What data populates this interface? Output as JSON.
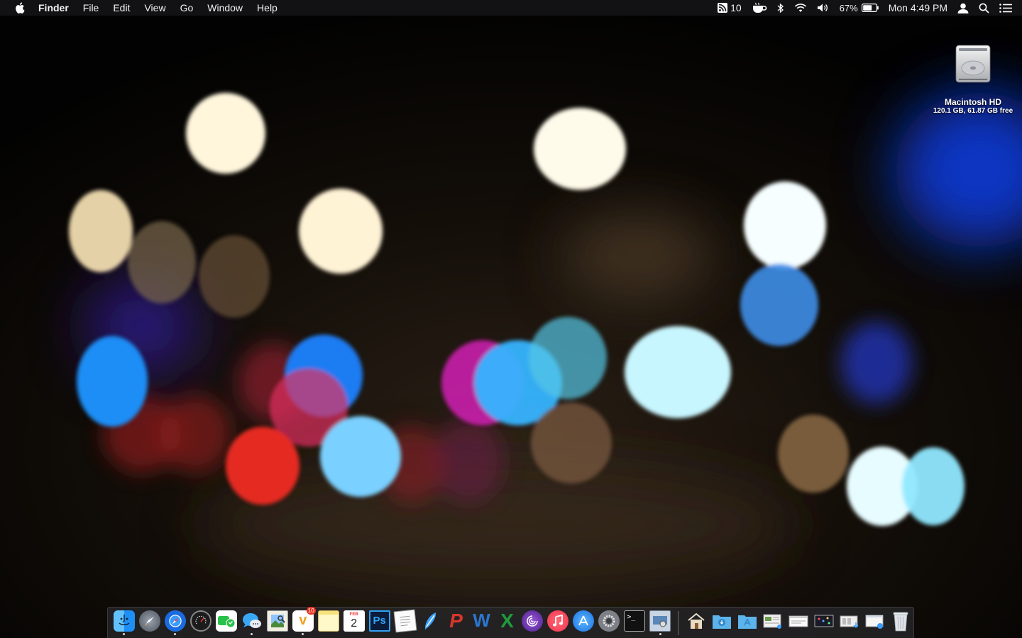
{
  "menubar": {
    "app_name": "Finder",
    "menus": [
      "File",
      "Edit",
      "View",
      "Go",
      "Window",
      "Help"
    ],
    "status": {
      "notifications_count": "10",
      "battery_percent": "67%",
      "clock": "Mon 4:49 PM"
    }
  },
  "desktop": {
    "drive_name": "Macintosh HD",
    "drive_info": "120.1 GB, 61.87 GB free"
  },
  "dock": {
    "calendar_month": "FEB",
    "calendar_day": "2",
    "vectorize_badge": "10",
    "apps": [
      {
        "name": "finder",
        "icon": "finder-icon",
        "running": true
      },
      {
        "name": "launchpad",
        "icon": "launchpad-icon",
        "running": false
      },
      {
        "name": "safari",
        "icon": "safari-icon",
        "running": true
      },
      {
        "name": "activity-monitor",
        "icon": "gauge-icon",
        "running": false
      },
      {
        "name": "facetime",
        "icon": "facetime-icon",
        "running": false
      },
      {
        "name": "messages",
        "icon": "messages-icon",
        "running": true
      },
      {
        "name": "preview",
        "icon": "preview-icon",
        "running": false
      },
      {
        "name": "vectorize",
        "icon": "v-icon",
        "running": true
      },
      {
        "name": "notes",
        "icon": "notes-icon",
        "running": false
      },
      {
        "name": "calendar",
        "icon": "calendar-icon",
        "running": false
      },
      {
        "name": "photoshop",
        "icon": "photoshop-icon",
        "running": false
      },
      {
        "name": "textedit",
        "icon": "textedit-icon",
        "running": false
      },
      {
        "name": "pen-app",
        "icon": "pen-icon",
        "running": false
      },
      {
        "name": "powerpoint",
        "icon": "p-icon",
        "running": false
      },
      {
        "name": "word",
        "icon": "w-icon",
        "running": false
      },
      {
        "name": "excel",
        "icon": "x-icon",
        "running": false
      },
      {
        "name": "bittorrent",
        "icon": "swirl-icon",
        "running": false
      },
      {
        "name": "itunes",
        "icon": "music-icon",
        "running": false
      },
      {
        "name": "app-store",
        "icon": "app-store-icon",
        "running": false
      },
      {
        "name": "system-preferences",
        "icon": "gear-icon",
        "running": false
      },
      {
        "name": "terminal",
        "icon": "terminal-icon",
        "running": false
      },
      {
        "name": "preview-window",
        "icon": "screenshot-icon",
        "running": true
      }
    ],
    "photoshop_label": "Ps",
    "terminal_label": ">_"
  },
  "colors": {
    "finder_blue": "#1e8ff5",
    "photoshop": "#0b1b3a",
    "powerpoint": "#d9362b",
    "word": "#2b76d1",
    "excel": "#1d9c3c",
    "itunes": "#f2334c"
  }
}
